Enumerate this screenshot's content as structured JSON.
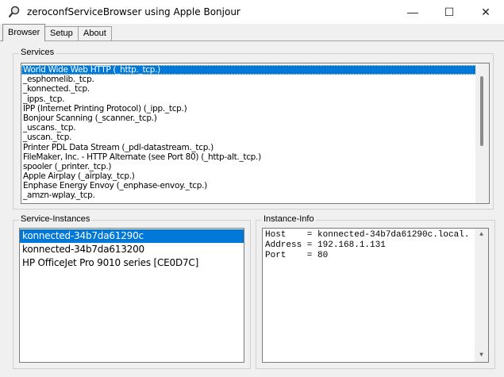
{
  "window": {
    "title": "zeroconfServiceBrowser using Apple Bonjour",
    "icon": "magnifier-icon",
    "controls": {
      "minimize": "—",
      "maximize": "☐",
      "close": "✕"
    }
  },
  "tabs": [
    {
      "label": "Browser",
      "active": true
    },
    {
      "label": "Setup",
      "active": false
    },
    {
      "label": "About",
      "active": false
    }
  ],
  "services": {
    "label": "Services",
    "items": [
      "World Wide Web HTTP (_http._tcp.)",
      "_esphomelib._tcp.",
      "_konnected._tcp.",
      "_ipps._tcp.",
      "IPP (Internet Printing Protocol) (_ipp._tcp.)",
      "Bonjour Scanning (_scanner._tcp.)",
      "_uscans._tcp.",
      "_uscan._tcp.",
      "Printer PDL Data Stream (_pdl-datastream._tcp.)",
      "FileMaker, Inc. - HTTP Alternate (see Port 80) (_http-alt._tcp.)",
      "spooler (_printer._tcp.)",
      "Apple Airplay (_airplay._tcp.)",
      "Enphase Energy Envoy (_enphase-envoy._tcp.)",
      "_amzn-wplay._tcp."
    ],
    "selected_index": 0
  },
  "service_instances": {
    "label": "Service-Instances",
    "items": [
      "konnected-34b7da61290c",
      "konnected-34b7da613200",
      "HP OfficeJet Pro 9010 series [CE0D7C]"
    ],
    "selected_index": 0
  },
  "instance_info": {
    "label": "Instance-Info",
    "lines": [
      "Host    = konnected-34b7da61290c.local.",
      "Address = 192.168.1.131",
      "Port    = 80"
    ]
  }
}
